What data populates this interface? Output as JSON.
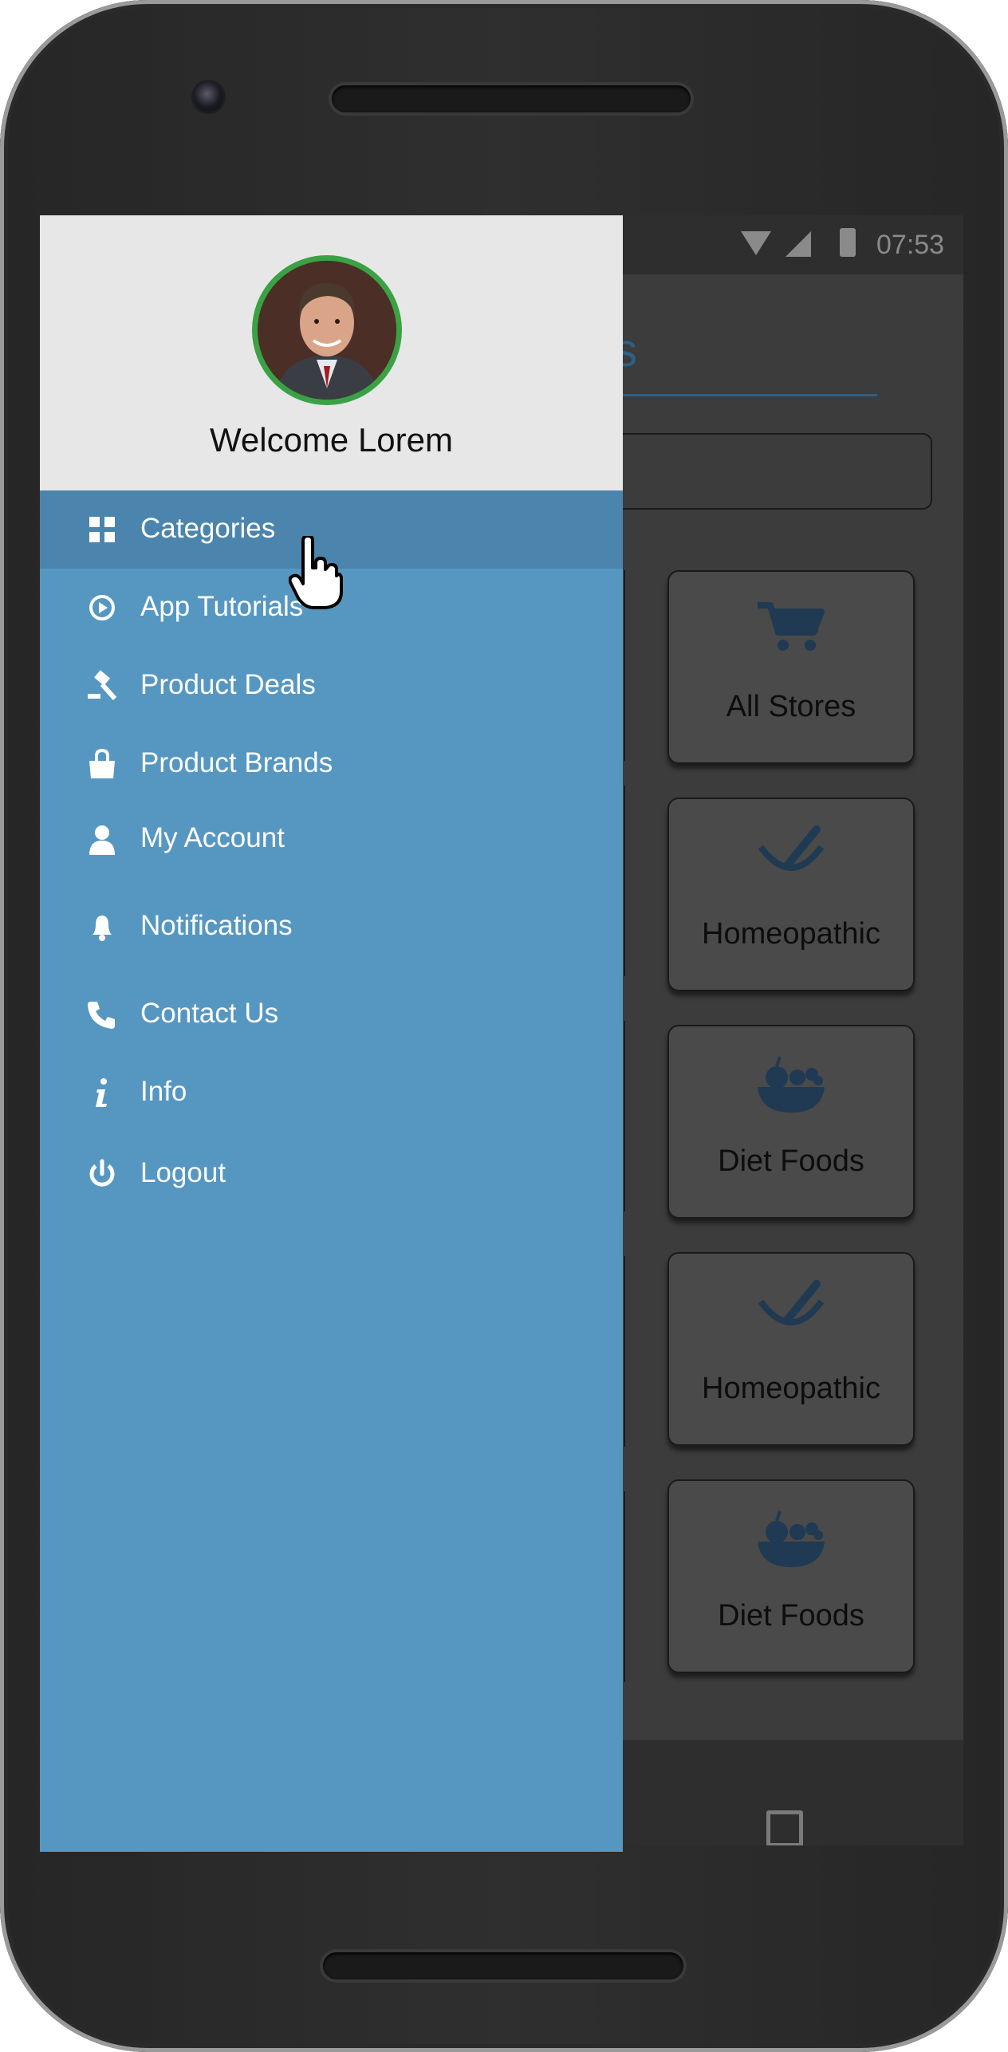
{
  "status_bar": {
    "time": "07:53"
  },
  "background_page": {
    "title_fragment": "s",
    "cards": [
      {
        "label": "All Stores",
        "icon": "cart-icon"
      },
      {
        "label": "Homeopathic",
        "icon": "mortar-pestle-icon"
      },
      {
        "label": "Diet Foods",
        "icon": "fruit-basket-icon"
      },
      {
        "label": "Homeopathic",
        "icon": "mortar-pestle-icon"
      },
      {
        "label": "Diet Foods",
        "icon": "fruit-basket-icon"
      }
    ]
  },
  "drawer": {
    "welcome": "Welcome Lorem",
    "items": [
      {
        "label": "Categories",
        "icon": "grid-icon",
        "active": true
      },
      {
        "label": "App Tutorials",
        "icon": "play-circle-icon"
      },
      {
        "label": "Product Deals",
        "icon": "gavel-icon"
      },
      {
        "label": "Product Brands",
        "icon": "shopping-bag-icon"
      },
      {
        "label": "My Account",
        "icon": "user-icon"
      },
      {
        "label": "Notifications",
        "icon": "bell-icon"
      },
      {
        "label": "Contact Us",
        "icon": "phone-icon"
      },
      {
        "label": "Info",
        "icon": "info-icon"
      },
      {
        "label": "Logout",
        "icon": "power-icon"
      }
    ]
  },
  "colors": {
    "drawer": "#5697c2",
    "drawer_active": "#4b85ad",
    "header": "#e7e7e7",
    "avatar_ring": "#3aa244",
    "card_icon": "#1f3a52"
  }
}
